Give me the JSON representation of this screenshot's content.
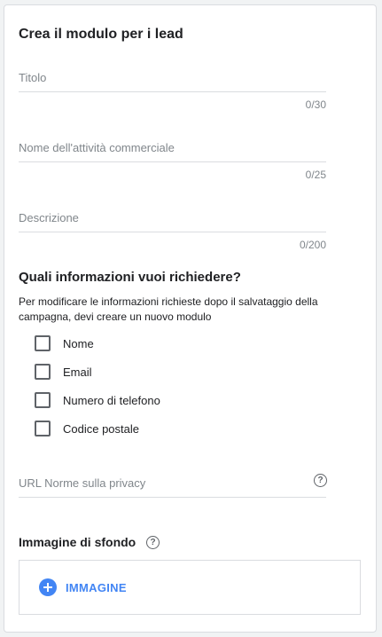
{
  "form": {
    "title": "Crea il modulo per i lead",
    "fields": [
      {
        "label": "Titolo",
        "counter": "0/30",
        "value": ""
      },
      {
        "label": "Nome dell'attività commerciale",
        "counter": "0/25",
        "value": ""
      },
      {
        "label": "Descrizione",
        "counter": "0/200",
        "value": ""
      }
    ]
  },
  "info_section": {
    "title": "Quali informazioni vuoi richiedere?",
    "description": "Per modificare le informazioni richieste dopo il salvataggio della campagna, devi creare un nuovo modulo",
    "options": [
      {
        "label": "Nome",
        "checked": false
      },
      {
        "label": "Email",
        "checked": false
      },
      {
        "label": "Numero di telefono",
        "checked": false
      },
      {
        "label": "Codice postale",
        "checked": false
      }
    ]
  },
  "privacy": {
    "label": "URL Norme sulla privacy",
    "value": "",
    "help_icon": "help-icon"
  },
  "background": {
    "title": "Immagine di sfondo",
    "help_icon": "help-icon",
    "add_label": "IMMAGINE"
  },
  "colors": {
    "accent": "#4285f4",
    "border": "#dadce0",
    "muted_text": "#80868b"
  }
}
